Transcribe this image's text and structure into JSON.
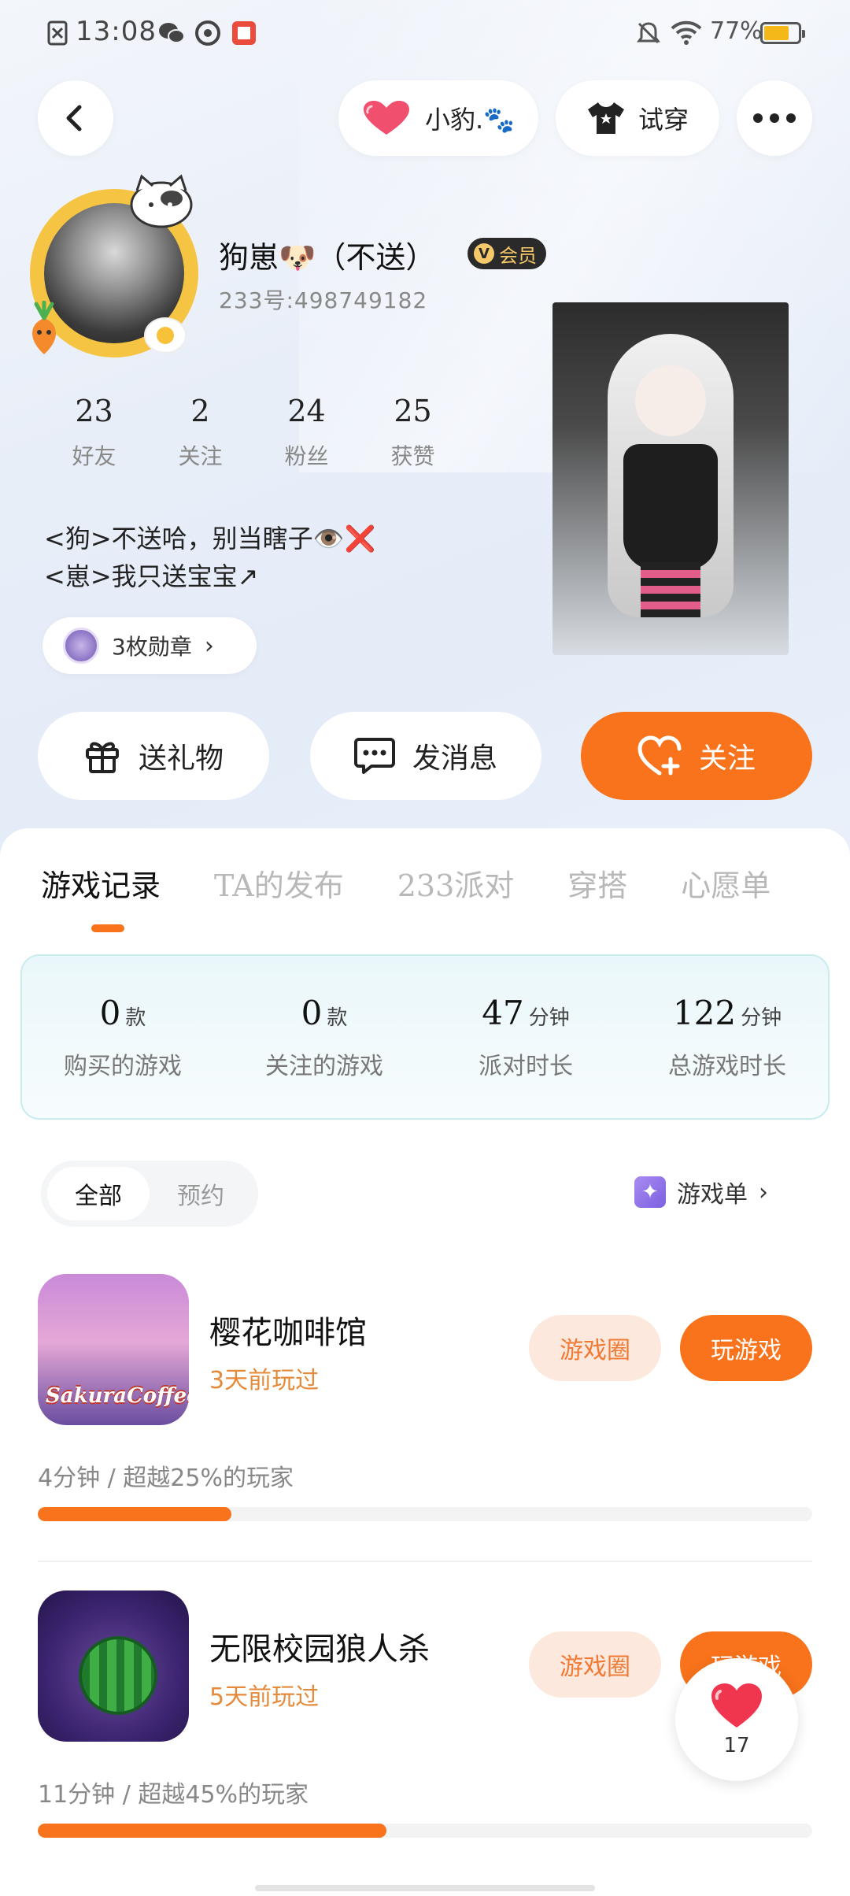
{
  "status_bar": {
    "time": "13:08",
    "battery": "77%",
    "battery_level": 0.77
  },
  "header": {
    "pet_label": "小豹.🐾",
    "outfit_label": "试穿"
  },
  "profile": {
    "nickname": "狗崽🐶（不送）",
    "vip_label": "会员",
    "uid": "233号:498749182",
    "stats": [
      {
        "value": "23",
        "label": "好友"
      },
      {
        "value": "2",
        "label": "关注"
      },
      {
        "value": "24",
        "label": "粉丝"
      },
      {
        "value": "25",
        "label": "获赞"
      }
    ],
    "bio_line1": "<狗>不送哈，别当瞎子👁️❌",
    "bio_line2": "<崽>我只送宝宝↗",
    "medals_label": "3枚勋章"
  },
  "actions": {
    "gift": "送礼物",
    "message": "发消息",
    "follow": "关注"
  },
  "tabs": [
    "游戏记录",
    "TA的发布",
    "233派对",
    "穿搭",
    "心愿单"
  ],
  "summary": [
    {
      "value": "0",
      "unit": "款",
      "label": "购买的游戏"
    },
    {
      "value": "0",
      "unit": "款",
      "label": "关注的游戏"
    },
    {
      "value": "47",
      "unit": "分钟",
      "label": "派对时长"
    },
    {
      "value": "122",
      "unit": "分钟",
      "label": "总游戏时长"
    }
  ],
  "filters": {
    "all": "全部",
    "reserved": "预约"
  },
  "game_list_label": "游戏单",
  "games": [
    {
      "title": "樱花咖啡馆",
      "icon_text": "SakuraCoffee",
      "played": "3天前玩过",
      "circle_btn": "游戏圈",
      "play_btn": "玩游戏",
      "stat": "4分钟 / 超越25%的玩家",
      "progress": 0.25
    },
    {
      "title": "无限校园狼人杀",
      "played": "5天前玩过",
      "circle_btn": "游戏圈",
      "play_btn": "玩游戏",
      "stat": "11分钟 / 超越45%的玩家",
      "progress": 0.45
    }
  ],
  "like_count": "17",
  "colors": {
    "accent": "#f8731b",
    "vip": "#f5c96a"
  }
}
